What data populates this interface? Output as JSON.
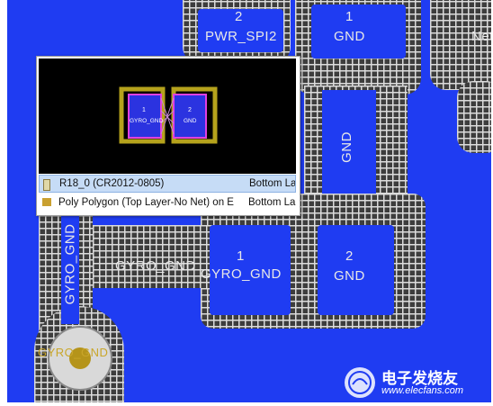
{
  "pcb": {
    "net_labels": {
      "pwr_spi2_num": "2",
      "pwr_spi2_name": "PWR_SPI2",
      "gnd_top_num": "1",
      "gnd_top_name": "GND",
      "right_edge": "Net",
      "gnd_vertical": "GND",
      "gyro_gnd_vertical": "GYRO_GND",
      "gyro_gnd_trace": "GYRO_GND",
      "pad1_num": "1",
      "pad1_name": "GYRO_GND",
      "pad2_num": "2",
      "pad2_name": "GND",
      "via_label": "GYRO_GND"
    },
    "colors": {
      "copper": "#1f3cf2",
      "polygon_hatch": "#3d3d3d",
      "grid": "#dcdcdc"
    }
  },
  "popup": {
    "preview": {
      "pad1_num": "1",
      "pad1_name": "GYRO_GND",
      "pad2_num": "2",
      "pad2_name": "GND"
    },
    "items": [
      {
        "icon": "component-icon",
        "label": "R18_0 (CR2012-0805)",
        "layer": "Bottom La",
        "selected": true
      },
      {
        "icon": "polygon-icon",
        "label": "Poly Polygon  (Top Layer-No Net)  on E",
        "layer": "Bottom La",
        "selected": false
      }
    ]
  },
  "watermark": {
    "brand": "电子发烧友",
    "url": "www.elecfans.com"
  }
}
